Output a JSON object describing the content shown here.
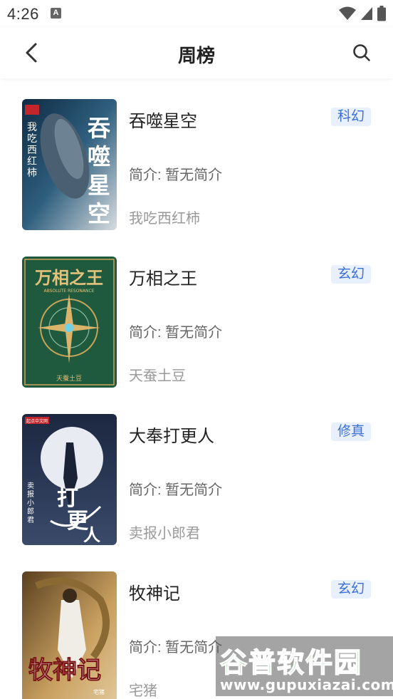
{
  "status_bar": {
    "time": "4:26",
    "notification_letter": "A"
  },
  "nav": {
    "title": "周榜"
  },
  "books": [
    {
      "title": "吞噬星空",
      "intro": "简介: 暂无简介",
      "author": "我吃西红柿",
      "tag": "科幻",
      "cover_title": "吞噬星空",
      "cover_author": "我吃西红柿"
    },
    {
      "title": "万相之王",
      "intro": "简介: 暂无简介",
      "author": "天蚕土豆",
      "tag": "玄幻",
      "cover_title": "万相之王",
      "cover_subtitle": "ABSOLUTE RESONANCE",
      "cover_author": "天蚕土豆"
    },
    {
      "title": "大奉打更人",
      "intro": "简介: 暂无简介",
      "author": "卖报小郎君",
      "tag": "修真",
      "cover_title": "打更人",
      "cover_prefix": "大奉",
      "cover_author": "卖报小郎君",
      "cover_badge": "起点中文网"
    },
    {
      "title": "牧神记",
      "intro": "简介: 暂无简介",
      "author": "宅猪",
      "tag": "玄幻",
      "cover_title": "牧神记",
      "cover_author": "宅猪"
    }
  ],
  "watermark": {
    "logo": "谷普软件园",
    "url": "www.gupuxiazai.com"
  },
  "colors": {
    "tag_bg": "#e8f0fe",
    "tag_text": "#3d6fd8",
    "title_text": "#222222",
    "intro_text": "#666666",
    "author_text": "#9a9a9a"
  }
}
